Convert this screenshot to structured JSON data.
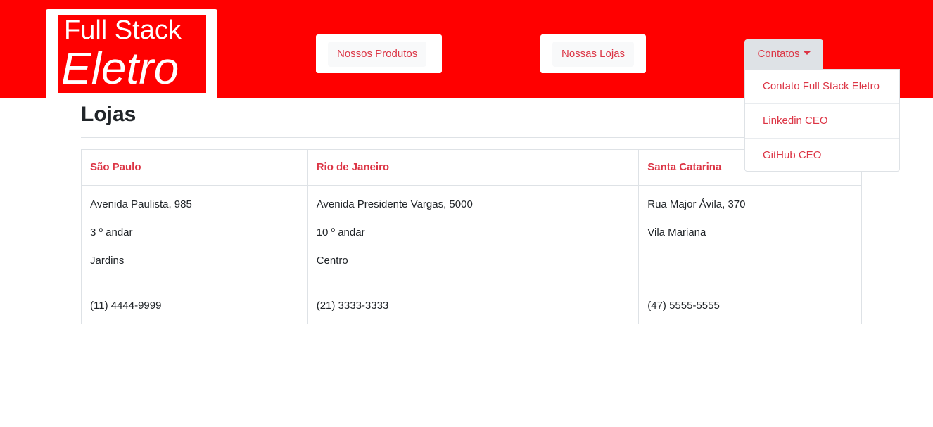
{
  "logo": {
    "line1": "Full Stack",
    "line2": "Eletro"
  },
  "nav": {
    "products_label": "Nossos Produtos",
    "stores_label": "Nossas Lojas",
    "contacts_label": "Contatos",
    "contacts_menu": [
      "Contato Full Stack Eletro",
      "Linkedin CEO",
      "GitHub CEO"
    ]
  },
  "page": {
    "title": "Lojas"
  },
  "stores": [
    {
      "name": "São Paulo",
      "address": [
        "Avenida Paulista, 985",
        "3 º andar",
        "Jardins"
      ],
      "phone": "(11) 4444-9999"
    },
    {
      "name": "Rio de Janeiro",
      "address": [
        "Avenida Presidente Vargas, 5000",
        "10 º andar",
        "Centro"
      ],
      "phone": "(21) 3333-3333"
    },
    {
      "name": "Santa Catarina",
      "address": [
        "Rua Major Ávila, 370",
        "Vila Mariana"
      ],
      "phone": "(47) 5555-5555"
    }
  ],
  "colors": {
    "header_bg": "#ff0000",
    "link": "#dc3545",
    "border": "#dee2e6"
  }
}
